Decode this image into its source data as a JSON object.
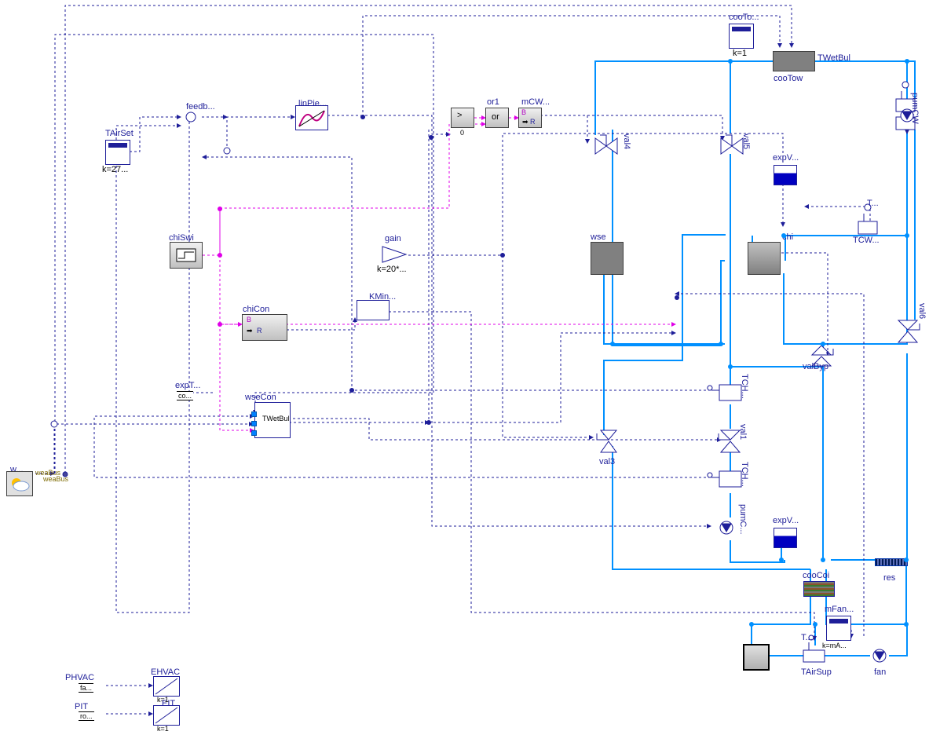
{
  "cooTo": {
    "l": "cooTo...",
    "k": "k=1"
  },
  "tWetBul": {
    "l": "TWetBul"
  },
  "cooTow": {
    "l": "cooTow"
  },
  "pumCW": {
    "l": "pumCW"
  },
  "feedb": {
    "l": "feedb..."
  },
  "linPie": {
    "l": "linPie..."
  },
  "or1": {
    "l": "or1",
    "a": "or",
    "gt": ">",
    "z": "0"
  },
  "mCW": {
    "l": "mCW...",
    "b": "B",
    "r": "R"
  },
  "tAirSet": {
    "l": "TAirSet",
    "k": "k=27..."
  },
  "val4": {
    "l": "val4"
  },
  "val5": {
    "l": "val5"
  },
  "expV1": {
    "l": "expV..."
  },
  "chiSwi": {
    "l": "chiSwi"
  },
  "gain": {
    "l": "gain",
    "k": "k=20*..."
  },
  "wse": {
    "l": "wse"
  },
  "chi": {
    "l": "chi"
  },
  "TCW": {
    "l": "TCW..."
  },
  "expT": {
    "l": "expT...",
    "co": "co..."
  },
  "chiCon": {
    "l": "chiCon",
    "b": "B",
    "r": "R"
  },
  "KMin": {
    "l": "KMin..."
  },
  "val6": {
    "l": "val6"
  },
  "valByp": {
    "l": "valByp"
  },
  "TCH1": {
    "l": "TCH..."
  },
  "wseCon": {
    "l": "wseCon"
  },
  "tWetBul2": {
    "l": "TWetBul"
  },
  "val1": {
    "l": "val1"
  },
  "T1": {
    "l": "T..."
  },
  "T2": {
    "l": "T..."
  },
  "val3": {
    "l": "val3"
  },
  "TCH2": {
    "l": "TCH..."
  },
  "pumC": {
    "l": "pumC..."
  },
  "expV2": {
    "l": "expV..."
  },
  "cooCoi": {
    "l": "cooCoi"
  },
  "res": {
    "l": "res"
  },
  "mFan": {
    "l": "mFan...",
    "k": "k=mA..."
  },
  "fan": {
    "l": "fan"
  },
  "TAirSup": {
    "l": "TAirSup"
  },
  "weaBus": {
    "l": "weaBus",
    "w": "w...",
    "wb": "weaBus"
  },
  "PHVAC": {
    "l": "PHVAC",
    "fa": "fa..."
  },
  "EHVAC": {
    "l": "EHVAC",
    "k": "k=1"
  },
  "PIT": {
    "l": "PIT",
    "ro": "ro..."
  },
  "EIT": {
    "l": "EIT",
    "k": "k=1"
  }
}
